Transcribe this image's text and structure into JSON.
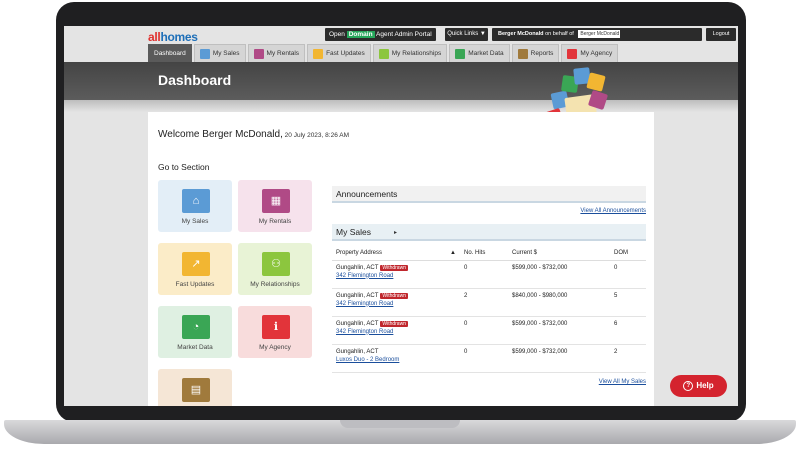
{
  "brand": {
    "all": "all",
    "homes": "homes"
  },
  "topbar": {
    "portal_prefix": "Open ",
    "portal_domain": "Domain",
    "portal_suffix": " Agent Admin Portal",
    "quick_links": "Quick Links ▼",
    "user_name": "Berger McDonald",
    "on_behalf": " on behalf of ",
    "on_behalf_select": "Berger McDonald",
    "logout": "Logout"
  },
  "nav": {
    "tabs": [
      {
        "label": "Dashboard",
        "active": true
      },
      {
        "label": "My Sales",
        "color": "#5b9bd5"
      },
      {
        "label": "My Rentals",
        "color": "#b04a86"
      },
      {
        "label": "Fast Updates",
        "color": "#f2b632"
      },
      {
        "label": "My Relationships",
        "color": "#8cc63e"
      },
      {
        "label": "Market Data",
        "color": "#3aa655"
      },
      {
        "label": "Reports",
        "color": "#a07a3c"
      },
      {
        "label": "My Agency",
        "color": "#e2343a"
      }
    ]
  },
  "page_title": "Dashboard",
  "welcome": {
    "text": "Welcome Berger McDonald,",
    "date": " 20 July 2023, 8:26 AM"
  },
  "goto": {
    "title": "Go to Section",
    "tiles": [
      {
        "label": "My Sales",
        "bg": "#e3eef7",
        "icon_bg": "#5b9bd5",
        "icon": "⌂"
      },
      {
        "label": "My Rentals",
        "bg": "#f6e2ec",
        "icon_bg": "#b04a86",
        "icon": "▦"
      },
      {
        "label": "Fast Updates",
        "bg": "#fbecc8",
        "icon_bg": "#f2b632",
        "icon": "↗"
      },
      {
        "label": "My Relationships",
        "bg": "#e8f3d6",
        "icon_bg": "#8cc63e",
        "icon": "⚇"
      },
      {
        "label": "Market Data",
        "bg": "#dff0e2",
        "icon_bg": "#3aa655",
        "icon": "◔"
      },
      {
        "label": "My Agency",
        "bg": "#f8dcdc",
        "icon_bg": "#e2343a",
        "icon": "ℹ"
      },
      {
        "label": "",
        "bg": "#f5e6d6",
        "icon_bg": "#a07a3c",
        "icon": "▤"
      }
    ]
  },
  "announcements": {
    "title": "Announcements",
    "view_all": "View All Announcements"
  },
  "my_sales": {
    "title": "My Sales",
    "columns": [
      "Property Address",
      "No. Hits",
      "Current $",
      "DOM"
    ],
    "rows": [
      {
        "suburb": "Gungahlin, ACT",
        "status": "Withdrawn",
        "address": "342 Flemington Road",
        "hits": "0",
        "price": "$599,000 - $732,000",
        "dom": "0"
      },
      {
        "suburb": "Gungahlin, ACT",
        "status": "Withdrawn",
        "address": "342 Flemington Road",
        "hits": "2",
        "price": "$840,000 - $980,000",
        "dom": "5"
      },
      {
        "suburb": "Gungahlin, ACT",
        "status": "Withdrawn",
        "address": "342 Flemington Road",
        "hits": "0",
        "price": "$599,000 - $732,000",
        "dom": "6"
      },
      {
        "suburb": "Gungahlin, ACT",
        "status": "",
        "address": "Luxos Duo - 2 Bedroom",
        "hits": "0",
        "price": "$599,000 - $732,000",
        "dom": "2"
      }
    ],
    "view_all": "View All My Sales"
  },
  "help": {
    "label": "Help"
  },
  "colors": {
    "accent": "#1e6fb8",
    "help": "#d4232e",
    "withdrawn": "#c0272d"
  }
}
